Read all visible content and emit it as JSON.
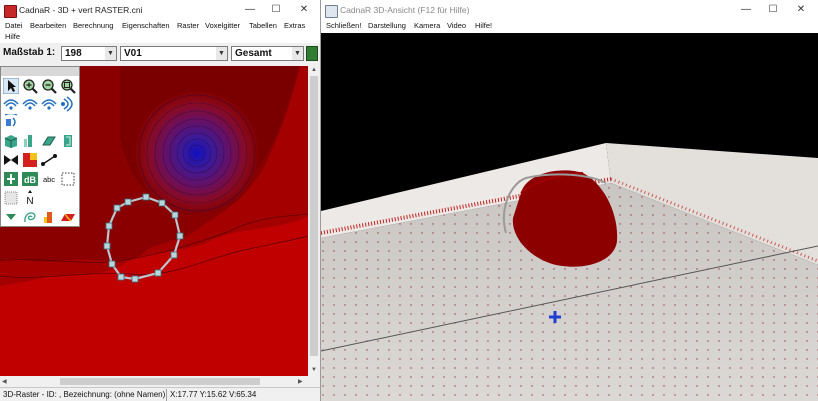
{
  "left_window": {
    "title": "CadnaR - 3D + vert RASTER.cni",
    "window_controls": {
      "minimize": "—",
      "maximize": "☐",
      "close": "✕"
    },
    "menu": [
      "Datei",
      "Bearbeiten",
      "Berechnung",
      "Eigenschaften",
      "Raster",
      "Voxelgitter",
      "Tabellen",
      "Extras",
      "Hilfe"
    ],
    "toolbar": {
      "scale_label": "Maßstab 1:",
      "scale_value": "198",
      "layer_value": "V01",
      "mode_value": "Gesamt"
    },
    "palette_tools": [
      "select-arrow-icon",
      "zoom-in-icon",
      "zoom-out-icon",
      "zoom-window-icon",
      "source-wave-icon",
      "source-wave-icon-2",
      "source-wave-icon-3",
      "source-wave-icon-4",
      "speaker-icon",
      "block-icon",
      "wall-icon",
      "panel-icon",
      "surface-icon",
      "absorber-icon",
      "grid-icon",
      "dimension-icon",
      "receiver-icon",
      "db-icon",
      "text-icon",
      "area-icon",
      "dotted-area-icon",
      "north-arrow-icon",
      "filter-icon",
      "sketch-icon",
      "bar-icon",
      "roof-icon"
    ],
    "palette_labels": {
      "db": "dB",
      "text": "abc",
      "north": "N"
    },
    "status": {
      "item": "3D-Raster - ID: , Bezeichnung: (ohne Namen)",
      "coords": "X:17.77 Y:15.62 V:65.34"
    },
    "colors": {
      "raster_dark": "#7a0000",
      "raster_mid": "#c00000",
      "raster_deep": "#1010c0"
    }
  },
  "right_window": {
    "title": "CadnaR 3D-Ansicht (F12 für Hilfe)",
    "window_controls": {
      "minimize": "—",
      "maximize": "☐",
      "close": "✕"
    },
    "menu": [
      "Schließen!",
      "Darstellung",
      "Kamera",
      "Video",
      "Hilfe!"
    ],
    "colors": {
      "sky": "#000000",
      "floor": "#d6d2cf",
      "wall": "#e8e4e0",
      "object": "#8c0000",
      "marker": "#1f3fd0"
    }
  }
}
